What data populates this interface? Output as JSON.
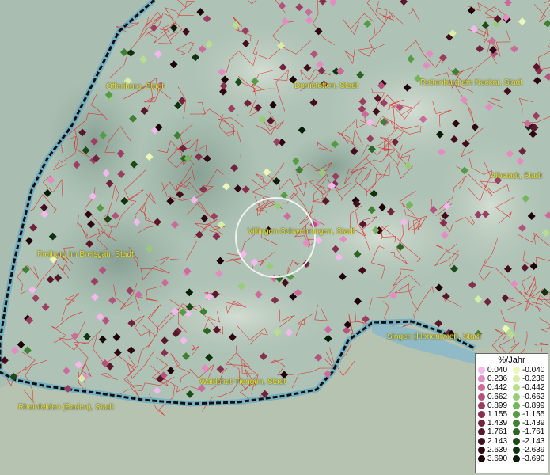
{
  "map": {
    "places": [
      {
        "name": "Offenburg, Stadt"
      },
      {
        "name": "Dornstetten, Stadt"
      },
      {
        "name": "Rottenburg am Neckar, Stadt"
      },
      {
        "name": "Albstadt, Stadt"
      },
      {
        "name": "Villingen-Schwenningen, Stadt"
      },
      {
        "name": "Freiburg im Breisgau, Stadt"
      },
      {
        "name": "Singen (Hohentwiel), Stadt"
      },
      {
        "name": "Waldshut-Tiengen, Stadt"
      },
      {
        "name": "Rheinfelden (Baden), Stadt"
      }
    ]
  },
  "legend": {
    "title": "%/Jahr",
    "positive": [
      {
        "label": "0.040",
        "color": "#f4b8ec"
      },
      {
        "label": "0.236",
        "color": "#e48cc2"
      },
      {
        "label": "0.442",
        "color": "#cc6a9a"
      },
      {
        "label": "0.662",
        "color": "#b5527c"
      },
      {
        "label": "0.899",
        "color": "#9c3e62"
      },
      {
        "label": "1.155",
        "color": "#87304e"
      },
      {
        "label": "1.439",
        "color": "#71223c"
      },
      {
        "label": "1.761",
        "color": "#5a162a"
      },
      {
        "label": "2.143",
        "color": "#440c1c"
      },
      {
        "label": "2.639",
        "color": "#300612"
      },
      {
        "label": "3.690",
        "color": "#1d020a"
      }
    ],
    "negative": [
      {
        "label": "-0.040",
        "color": "#eef6b8"
      },
      {
        "label": "-0.236",
        "color": "#d6eea6"
      },
      {
        "label": "-0.442",
        "color": "#b8de8e"
      },
      {
        "label": "-0.662",
        "color": "#98cc78"
      },
      {
        "label": "-0.899",
        "color": "#76b55c"
      },
      {
        "label": "-1.155",
        "color": "#579b44"
      },
      {
        "label": "-1.439",
        "color": "#3f8032"
      },
      {
        "label": "-1.761",
        "color": "#2c6624"
      },
      {
        "label": "-2.143",
        "color": "#1c4c16"
      },
      {
        "label": "-2.639",
        "color": "#0f330c"
      },
      {
        "label": "-3.690",
        "color": "#061c04"
      }
    ]
  }
}
